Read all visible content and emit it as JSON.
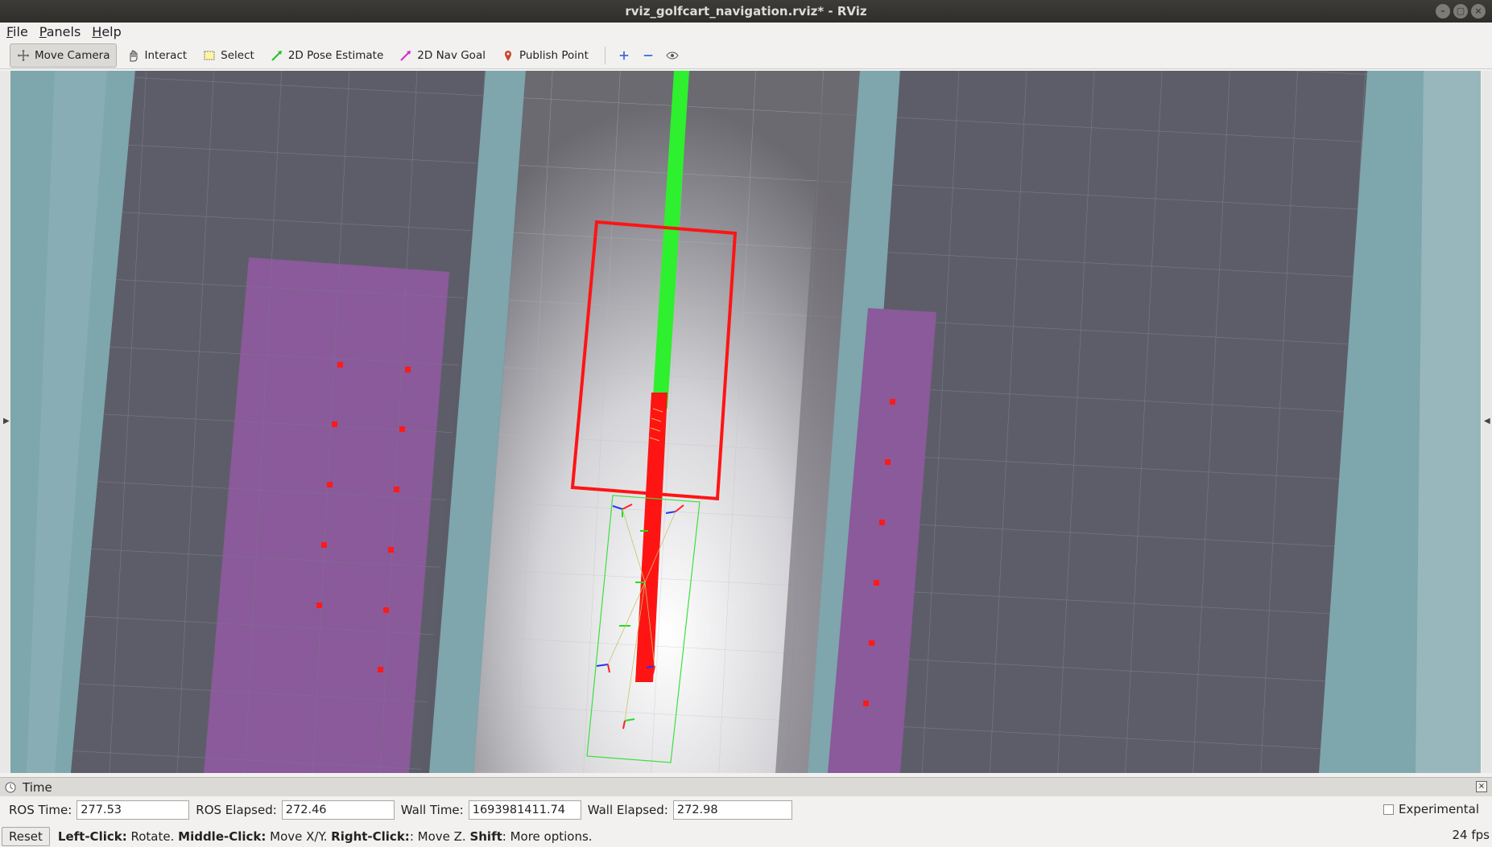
{
  "window": {
    "title": "rviz_golfcart_navigation.rviz* - RViz"
  },
  "menu": [
    "File",
    "Panels",
    "Help"
  ],
  "toolbar": {
    "move_camera": "Move Camera",
    "interact": "Interact",
    "select": "Select",
    "pose_estimate": "2D Pose Estimate",
    "nav_goal": "2D Nav Goal",
    "publish_point": "Publish Point"
  },
  "icons": {
    "move_camera": "move-camera-icon",
    "interact": "hand-icon",
    "select": "select-box-icon",
    "pose_estimate": "green-arrow-icon",
    "nav_goal": "magenta-arrow-icon",
    "publish_point": "map-pin-icon",
    "add": "plus-icon",
    "remove": "minus-icon",
    "view": "eye-icon"
  },
  "colors": {
    "path": "#2ef02e",
    "footprint": "#ff1414",
    "costmap_lane": "#8a5a9a",
    "grid_bg": "#5b5b66",
    "marker": "#ff1a1a"
  },
  "time_panel": {
    "title": "Time",
    "ros_time_label": "ROS Time:",
    "ros_time": "277.53",
    "ros_elapsed_label": "ROS Elapsed:",
    "ros_elapsed": "272.46",
    "wall_time_label": "Wall Time:",
    "wall_time": "1693981411.74",
    "wall_elapsed_label": "Wall Elapsed:",
    "wall_elapsed": "272.98",
    "experimental_label": "Experimental"
  },
  "status": {
    "reset": "Reset",
    "left_click": "Left-Click:",
    "left_action": " Rotate. ",
    "middle_click": "Middle-Click:",
    "middle_action": " Move X/Y. ",
    "right_click": "Right-Click:",
    "right_action": ": Move Z. ",
    "shift": "Shift",
    "shift_action": ": More options.",
    "fps": "24 fps"
  }
}
